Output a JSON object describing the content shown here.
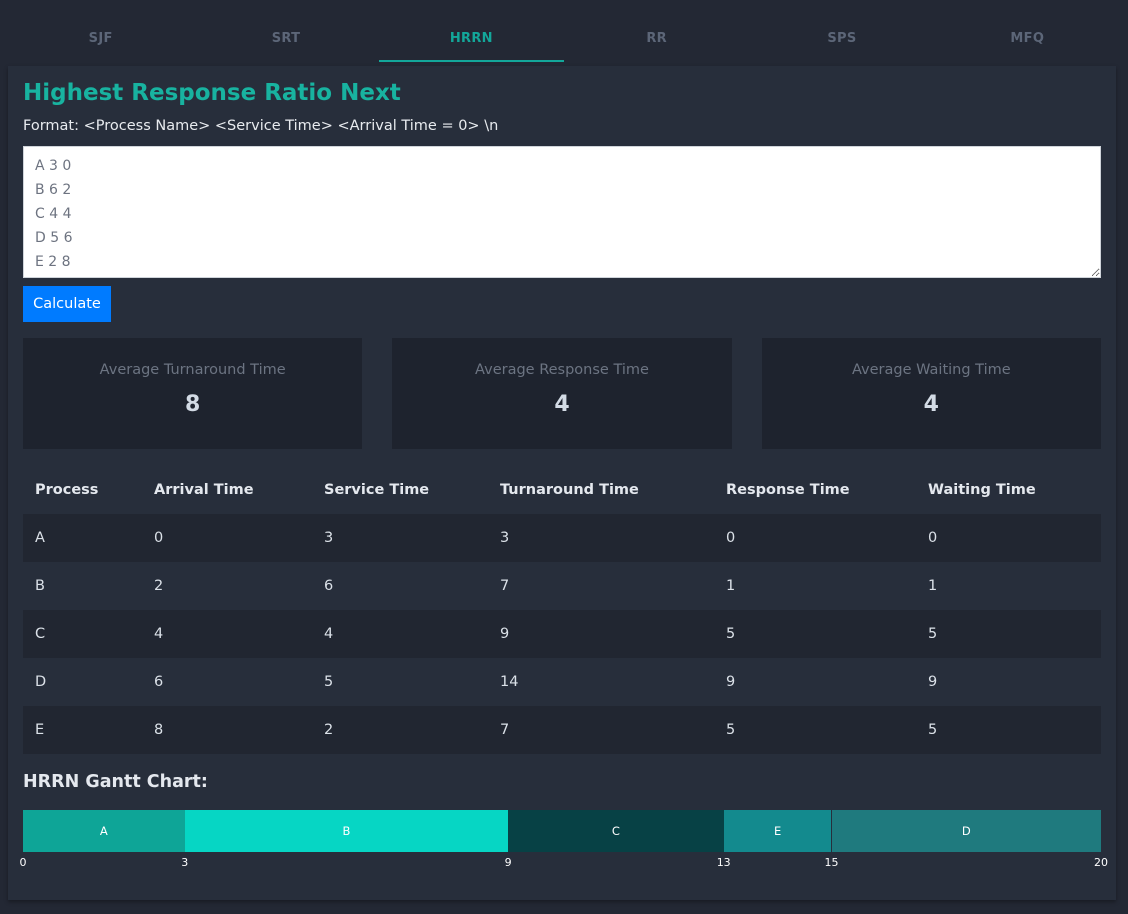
{
  "tabs": [
    {
      "label": "SJF",
      "active": false
    },
    {
      "label": "SRT",
      "active": false
    },
    {
      "label": "HRRN",
      "active": true
    },
    {
      "label": "RR",
      "active": false
    },
    {
      "label": "SPS",
      "active": false
    },
    {
      "label": "MFQ",
      "active": false
    }
  ],
  "page": {
    "title": "Highest Response Ratio Next",
    "format": "Format: <Process Name> <Service Time> <Arrival Time = 0> \\n",
    "input_value": "A 3 0\nB 6 2\nC 4 4\nD 5 6\nE 2 8",
    "calculate_label": "Calculate"
  },
  "stats": [
    {
      "label": "Average Turnaround Time",
      "value": "8"
    },
    {
      "label": "Average Response Time",
      "value": "4"
    },
    {
      "label": "Average Waiting Time",
      "value": "4"
    }
  ],
  "table": {
    "headers": [
      "Process",
      "Arrival Time",
      "Service Time",
      "Turnaround Time",
      "Response Time",
      "Waiting Time"
    ],
    "rows": [
      [
        "A",
        "0",
        "3",
        "3",
        "0",
        "0"
      ],
      [
        "B",
        "2",
        "6",
        "7",
        "1",
        "1"
      ],
      [
        "C",
        "4",
        "4",
        "9",
        "5",
        "5"
      ],
      [
        "D",
        "6",
        "5",
        "14",
        "9",
        "9"
      ],
      [
        "E",
        "8",
        "2",
        "7",
        "5",
        "5"
      ]
    ]
  },
  "gantt": {
    "title": "HRRN Gantt Chart:",
    "total": 20,
    "segments": [
      {
        "label": "A",
        "start": 0,
        "end": 3,
        "color": "#0ea597"
      },
      {
        "label": "B",
        "start": 3,
        "end": 9,
        "color": "#06d6c4"
      },
      {
        "label": "C",
        "start": 9,
        "end": 13,
        "color": "#074145"
      },
      {
        "label": "E",
        "start": 13,
        "end": 15,
        "color": "#138a8e"
      },
      {
        "label": "D",
        "start": 15,
        "end": 20,
        "color": "#1f7a7e"
      }
    ],
    "ticks": [
      "0",
      "3",
      "9",
      "13",
      "15",
      "20"
    ]
  }
}
